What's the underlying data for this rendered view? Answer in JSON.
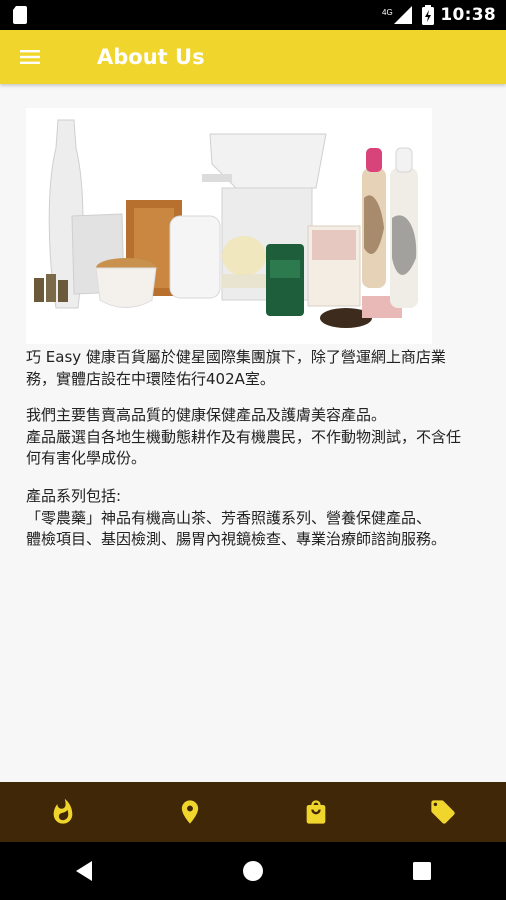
{
  "status_bar": {
    "network": "4G",
    "time": "10:38"
  },
  "app_bar": {
    "title": "About Us",
    "menu_icon": "hamburger-menu-icon"
  },
  "about": {
    "image": "product-collage",
    "paragraph1": "巧 Easy 健康百貨屬於健星國際集團旗下，除了營運網上商店業務，實體店設在中環陸佑行402A室。",
    "paragraph2_line1": "我們主要售賣高品質的健康保健產品及護膚美容產品。",
    "paragraph2_line2": "產品嚴選自各地生機動態耕作及有機農民，不作動物測試，不含任何有害化學成份。",
    "paragraph3_line1": "產品系列包括:",
    "paragraph3_line2": "「零農藥」神品有機高山茶、芳香照護系列、營養保健產品、",
    "paragraph3_line3": "體檢項目、基因檢測、腸胃內視鏡檢查、專業治療師諮詢服務。"
  },
  "bottom_nav": {
    "items": [
      {
        "icon": "fire-icon"
      },
      {
        "icon": "location-pin-icon"
      },
      {
        "icon": "shopping-bag-icon"
      },
      {
        "icon": "tag-icon"
      }
    ]
  },
  "colors": {
    "app_bar": "#f0d52c",
    "bottom_nav": "#3f2707",
    "nav_icon": "#f0d52c"
  }
}
